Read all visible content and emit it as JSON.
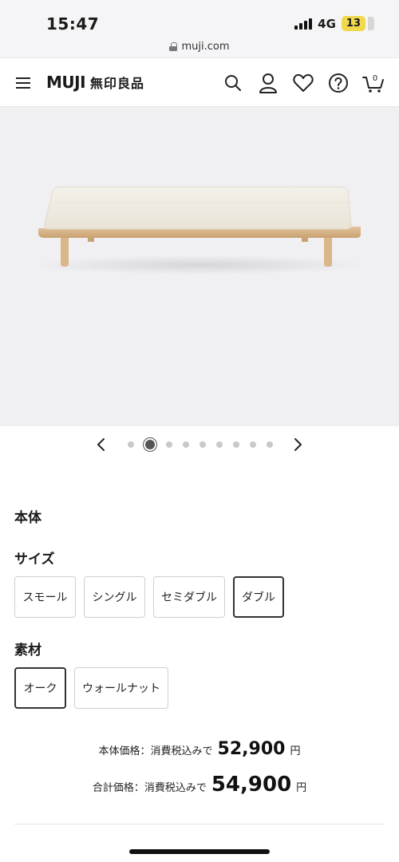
{
  "status_bar": {
    "time": "15:47",
    "network": "4G",
    "battery": "13"
  },
  "url": {
    "domain": "muji.com"
  },
  "header": {
    "logo_en": "MUJI",
    "logo_jp": "無印良品",
    "icons": [
      "search-icon",
      "user-icon",
      "heart-icon",
      "help-icon",
      "cart-icon"
    ],
    "cart_count": "0"
  },
  "carousel": {
    "total": 9,
    "active_index": 1
  },
  "body_section": {
    "title": "本体"
  },
  "size": {
    "title": "サイズ",
    "options": [
      "スモール",
      "シングル",
      "セミダブル",
      "ダブル"
    ],
    "selected": "ダブル"
  },
  "material": {
    "title": "素材",
    "options": [
      "オーク",
      "ウォールナット"
    ],
    "selected": "オーク"
  },
  "prices": {
    "body_label": "本体価格：消費税込みで",
    "body_value": "52,900",
    "total_label": "合計価格：消費税込みで",
    "total_value": "54,900",
    "currency": "円"
  },
  "colors": {
    "accent": "#333333",
    "battery": "#f1d94e",
    "image_bg": "#f0f0f2"
  }
}
